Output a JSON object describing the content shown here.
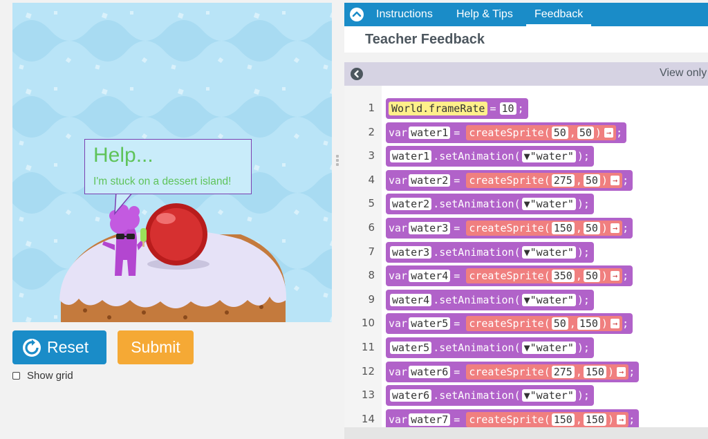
{
  "stage": {
    "bubble_title": "Help...",
    "bubble_text": "I'm stuck on a dessert island!"
  },
  "controls": {
    "reset_label": "Reset",
    "submit_label": "Submit",
    "show_grid_label": "Show grid",
    "show_grid_checked": false
  },
  "tabs": [
    {
      "label": "Instructions"
    },
    {
      "label": "Help & Tips"
    },
    {
      "label": "Feedback"
    }
  ],
  "feedback": {
    "title": "Teacher Feedback",
    "view_only": "View only"
  },
  "code": {
    "lines": [
      {
        "n": "1",
        "kind": "assign",
        "target": "World.frameRate",
        "value": "10"
      },
      {
        "n": "2",
        "kind": "var",
        "name": "water1",
        "fn": "createSprite",
        "a": "50",
        "b": "50"
      },
      {
        "n": "3",
        "kind": "anim",
        "name": "water1",
        "method": ".setAnimation(",
        "arg": "\"water\""
      },
      {
        "n": "4",
        "kind": "var",
        "name": "water2",
        "fn": "createSprite",
        "a": "275",
        "b": "50"
      },
      {
        "n": "5",
        "kind": "anim",
        "name": "water2",
        "method": ".setAnimation(",
        "arg": "\"water\""
      },
      {
        "n": "6",
        "kind": "var",
        "name": "water3",
        "fn": "createSprite",
        "a": "150",
        "b": "50"
      },
      {
        "n": "7",
        "kind": "anim",
        "name": "water3",
        "method": ".setAnimation(",
        "arg": "\"water\""
      },
      {
        "n": "8",
        "kind": "var",
        "name": "water4",
        "fn": "createSprite",
        "a": "350",
        "b": "50"
      },
      {
        "n": "9",
        "kind": "anim",
        "name": "water4",
        "method": ".setAnimation(",
        "arg": "\"water\""
      },
      {
        "n": "10",
        "kind": "var",
        "name": "water5",
        "fn": "createSprite",
        "a": "50",
        "b": "150"
      },
      {
        "n": "11",
        "kind": "anim",
        "name": "water5",
        "method": ".setAnimation(",
        "arg": "\"water\""
      },
      {
        "n": "12",
        "kind": "var",
        "name": "water6",
        "fn": "createSprite",
        "a": "275",
        "b": "150"
      },
      {
        "n": "13",
        "kind": "anim",
        "name": "water6",
        "method": ".setAnimation(",
        "arg": "\"water\""
      },
      {
        "n": "14",
        "kind": "var",
        "name": "water7",
        "fn": "createSprite",
        "a": "150",
        "b": "150"
      }
    ]
  },
  "colors": {
    "brand_blue": "#1a8cc8",
    "submit_orange": "#f5a935",
    "block_purple": "#b162c9",
    "block_red": "#f07f7f",
    "highlight_yellow": "#fff08a"
  }
}
